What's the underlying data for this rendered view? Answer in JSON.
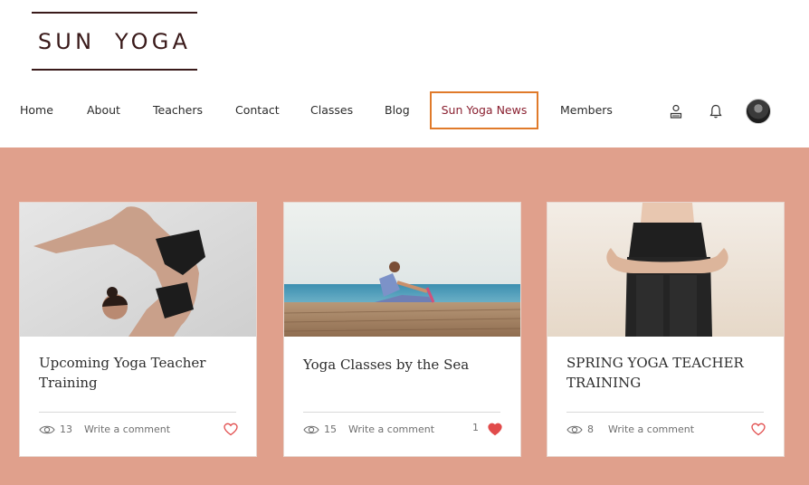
{
  "site": {
    "logo_text": "SUN YOGA"
  },
  "nav": {
    "items": [
      {
        "label": "Home"
      },
      {
        "label": "About"
      },
      {
        "label": "Teachers"
      },
      {
        "label": "Contact"
      },
      {
        "label": "Classes"
      },
      {
        "label": "Blog"
      },
      {
        "label": "Sun Yoga News",
        "active": true
      },
      {
        "label": "Members"
      }
    ]
  },
  "header_icons": [
    "account-icon",
    "notification-bell-icon",
    "avatar"
  ],
  "colors": {
    "background": "#e0a08c",
    "active_nav_border": "#e07a2a",
    "active_nav_text": "#8a2030",
    "logo": "#3a1a1a",
    "heart": "#e14b4b"
  },
  "posts": [
    {
      "title": "Upcoming Yoga Teacher Training",
      "views": "13",
      "comment_label": "Write a comment",
      "likes": "",
      "liked": false,
      "image": "yoga-pose-photo"
    },
    {
      "title": "Yoga Classes by the Sea",
      "views": "15",
      "comment_label": "Write a comment",
      "likes": "1",
      "liked": true,
      "image": "beach-stretch-photo"
    },
    {
      "title": "SPRING YOGA TEACHER TRAINING",
      "views": "8",
      "comment_label": "Write a comment",
      "likes": "",
      "liked": false,
      "image": "seated-yoga-photo"
    }
  ]
}
